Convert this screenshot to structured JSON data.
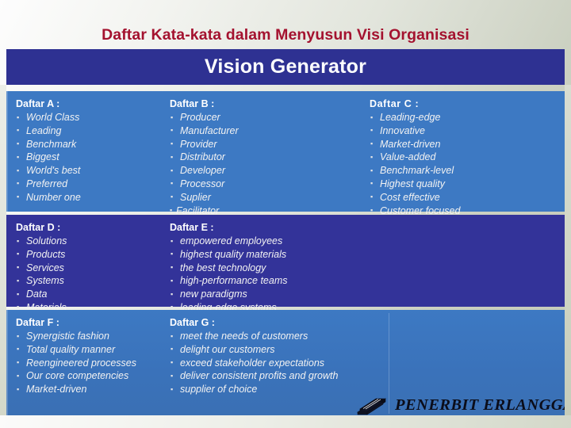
{
  "slide": {
    "title": "Daftar Kata-kata dalam Menyusun Visi Organisasi",
    "banner": "Vision Generator",
    "title_color": "#a4122f",
    "banner_bg": "#2e3192",
    "band_light_blue": "#3d79c3",
    "band_dark_blue": "#333399"
  },
  "lists": {
    "a": {
      "heading": "Daftar A :",
      "items": [
        "World Class",
        "Leading",
        "Benchmark",
        "Biggest",
        "World's best",
        "Preferred",
        "Number one"
      ]
    },
    "b": {
      "heading": "Daftar B :",
      "items": [
        "Producer",
        "Manufacturer",
        "Provider",
        "Distributor",
        "Developer",
        "Processor",
        "Suplier",
        "Facilitator"
      ]
    },
    "c": {
      "heading": "Daftar C :",
      "items": [
        "Leading-edge",
        "Innovative",
        "Market-driven",
        "Value-added",
        "Benchmark-level",
        "Highest quality",
        "Cost effective",
        "Customer focused"
      ]
    },
    "d": {
      "heading": "Daftar D :",
      "items": [
        "Solutions",
        "Products",
        "Services",
        "Systems",
        "Data",
        "Materials"
      ]
    },
    "e": {
      "heading": "Daftar E :",
      "items": [
        "empowered employees",
        "highest quality materials",
        "the best technology",
        "high-performance teams",
        "new paradigms",
        "leading-edge systems"
      ]
    },
    "f": {
      "heading": "Daftar F :",
      "items": [
        "Synergistic fashion",
        "Total quality manner",
        "Reengineered processes",
        "Our core competencies",
        "Market-driven"
      ]
    },
    "g": {
      "heading": "Daftar G :",
      "items": [
        "meet the needs of customers",
        "delight our customers",
        "exceed stakeholder expectations",
        "deliver consistent profits and growth",
        "supplier of choice"
      ]
    }
  },
  "publisher": {
    "name": "PENERBIT ERLANGGA",
    "logo": "stacked-books-icon"
  }
}
